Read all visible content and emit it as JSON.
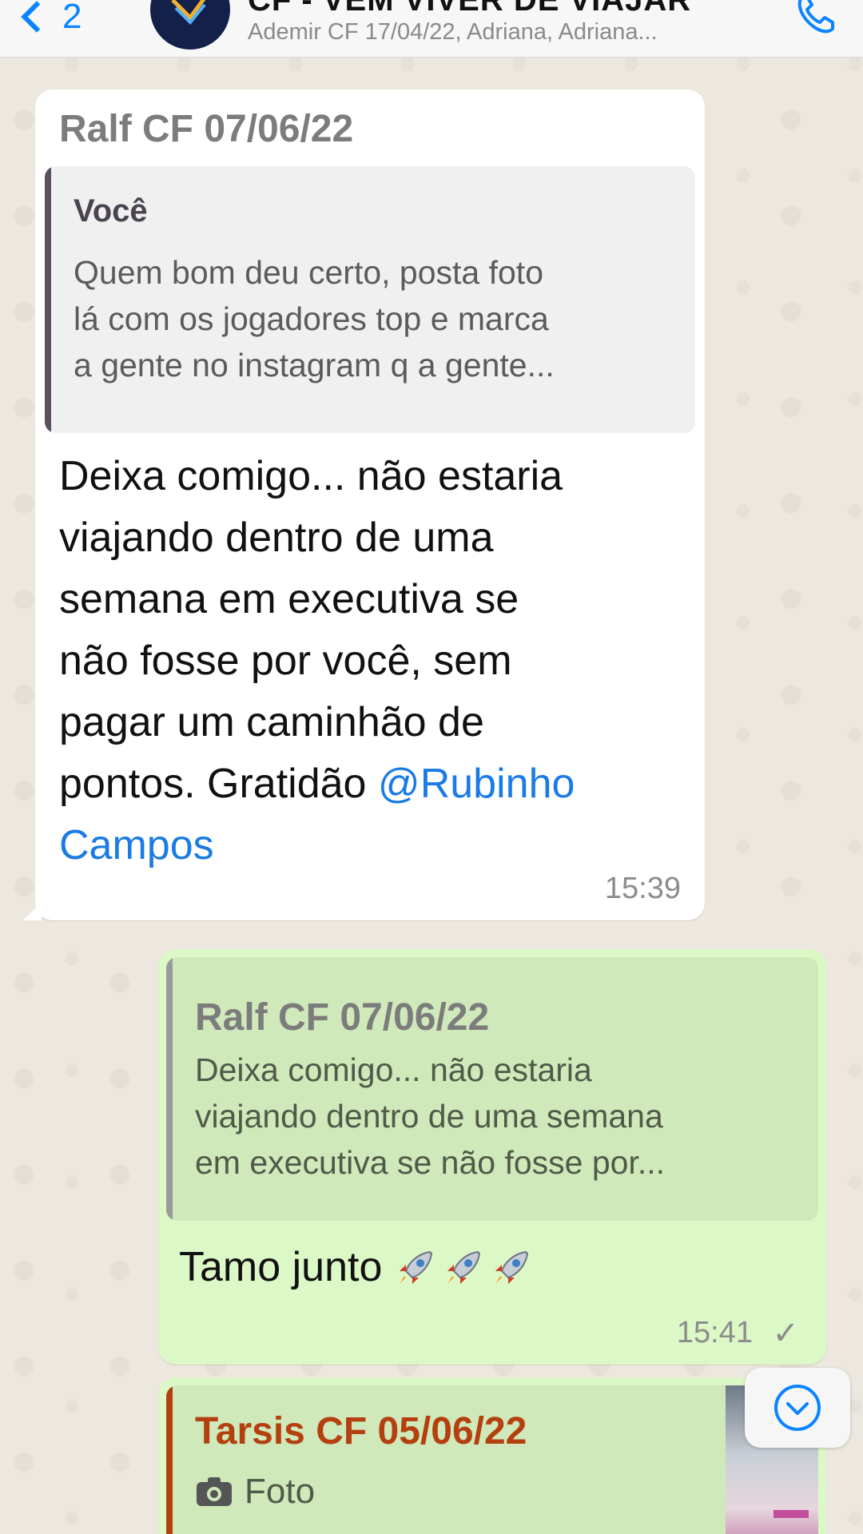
{
  "header": {
    "back_count": "2",
    "group_title": "CF - VEM VIVER DE VIAJAR",
    "group_subtitle": "Ademir CF 17/04/22, Adriana, Adriana..."
  },
  "messages": [
    {
      "sender": "Ralf CF 07/06/22",
      "quote": {
        "author": "Você",
        "lines": [
          "Quem bom deu certo, posta foto",
          "lá com os jogadores top e marca",
          "a gente no instagram q a gente..."
        ]
      },
      "lines": [
        "Deixa comigo... não estaria",
        "viajando dentro de uma",
        "semana em executiva se",
        "não fosse por você, sem",
        "pagar um caminhão de",
        "pontos. Gratidão "
      ],
      "mention_part1": "@Rubinho",
      "mention_part2": "Campos",
      "time": "15:39"
    },
    {
      "quote": {
        "author": "Ralf CF 07/06/22",
        "lines": [
          "Deixa comigo... não estaria",
          "viajando dentro de uma semana",
          "em executiva se não fosse por..."
        ]
      },
      "text": "Tamo junto",
      "time": "15:41",
      "tick": "✓"
    },
    {
      "quote": {
        "author": "Tarsis CF 05/06/22",
        "media_label": "Foto"
      }
    }
  ],
  "colors": {
    "accent": "#0a84ff",
    "outgoing_bubble": "#dcf8c6",
    "incoming_bubble": "#ffffff",
    "mention": "#1a7be6",
    "tarsis_name": "#b5400f",
    "quote_bar_you": "#5a5060",
    "quote_bar_ralf": "#9a9a9a"
  },
  "icons": [
    "back-chevron-icon",
    "group-avatar-logo",
    "phone-call-icon",
    "rocket-emoji",
    "camera-icon",
    "chevron-down-icon"
  ]
}
